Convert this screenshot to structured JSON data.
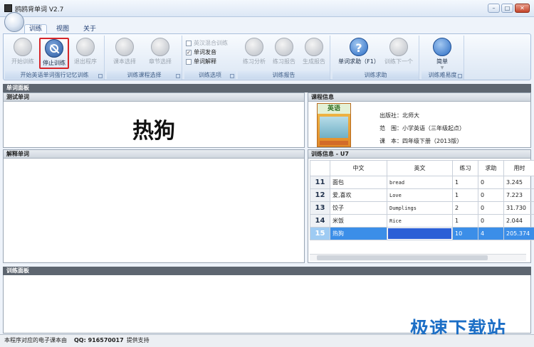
{
  "window": {
    "title": "鸥鸥背单词 V2.7",
    "minimize_glyph": "–",
    "maximize_glyph": "□",
    "close_glyph": "✕"
  },
  "tabs": [
    {
      "label": "训练",
      "active": true
    },
    {
      "label": "视图",
      "active": false
    },
    {
      "label": "关于",
      "active": false
    }
  ],
  "ribbon": {
    "groups": {
      "memory": {
        "label": "开始英语单词强行记忆训练",
        "buttons": {
          "start": "开始训练",
          "stop": "停止训练",
          "exit": "退出程序"
        }
      },
      "course": {
        "label": "训练课程选择",
        "buttons": {
          "book": "课本选择",
          "chapter": "章节选择"
        }
      },
      "options": {
        "label": "训练选项",
        "checks": [
          {
            "label": "英汉混合训练",
            "checked": false,
            "enabled": false
          },
          {
            "label": "单词发音",
            "checked": true,
            "enabled": true
          },
          {
            "label": "单词解释",
            "checked": false,
            "enabled": true
          }
        ]
      },
      "report": {
        "label": "训练报告",
        "buttons": {
          "analysis": "练习分析",
          "practice_report": "练习报告",
          "generate_report": "生成报告"
        }
      },
      "help": {
        "label": "训练求助",
        "buttons": {
          "word_help": "单词求助（F1）",
          "next": "训练下一个"
        }
      },
      "difficulty": {
        "label": "训练难易度",
        "buttons": {
          "simple": "简单"
        }
      }
    }
  },
  "word_panel": {
    "band_title": "单词面板"
  },
  "test_word": {
    "title": "测试单词",
    "word": "热狗"
  },
  "course_info": {
    "title": "课程信息",
    "cover_title": "英语",
    "publisher": "出版社：北师大",
    "scope": "范　围：小学英语（三年级起点）",
    "book": "课　本：四年级下册（2013版）"
  },
  "explain_word": {
    "title": "解释单词"
  },
  "training_info": {
    "title": "训练信息 - U7",
    "columns": [
      "中文",
      "英文",
      "练习",
      "求助",
      "用时"
    ],
    "rows": [
      {
        "num": "11",
        "zh": "面包",
        "en": "bread",
        "practice": "1",
        "help": "0",
        "time": "3.245"
      },
      {
        "num": "12",
        "zh": "爱,喜欢",
        "en": "Love",
        "practice": "1",
        "help": "0",
        "time": "7.223"
      },
      {
        "num": "13",
        "zh": "饺子",
        "en": "Dumplings",
        "practice": "2",
        "help": "0",
        "time": "31.730"
      },
      {
        "num": "14",
        "zh": "米饭",
        "en": "Rice",
        "practice": "1",
        "help": "0",
        "time": "2.044"
      },
      {
        "num": "15",
        "zh": "热狗",
        "en": "",
        "practice": "10",
        "help": "4",
        "time": "205.374"
      }
    ]
  },
  "training_panel": {
    "band_title": "训练面板"
  },
  "status": {
    "text": "本程序对应的电子课本由",
    "qq_label": "QQ: 916570017",
    "suffix": "提供支持"
  },
  "watermark": "极速下载站"
}
